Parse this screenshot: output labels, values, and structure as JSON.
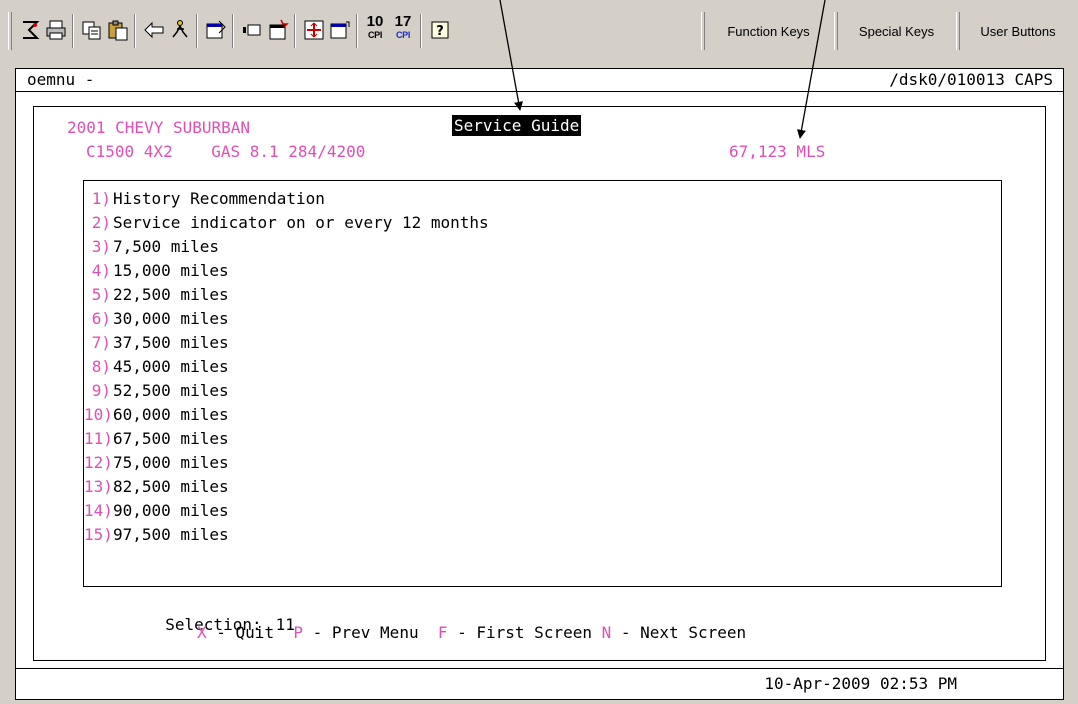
{
  "toolbar": {
    "icons": [
      "printer-setup-icon",
      "print-icon",
      "copy-icon",
      "paste-icon",
      "back-arrow-icon",
      "run-icon",
      "properties-icon",
      "record-icon",
      "new-window-icon",
      "fullscreen-icon",
      "exit-window-icon",
      "help-icon"
    ],
    "cpi_10": {
      "num": "10",
      "lbl": "CPI"
    },
    "cpi_17": {
      "num": "17",
      "lbl": "CPI"
    },
    "function_keys": "Function Keys",
    "special_keys": "Special Keys",
    "user_buttons": "User Buttons"
  },
  "terminal": {
    "header_left": "oemnu -",
    "header_right": "/dsk0/010013 CAPS",
    "vehicle_line1": "2001 CHEVY SUBURBAN",
    "vehicle_line2": "C1500 4X2    GAS 8.1 284/4200",
    "title": "Service Guide",
    "mileage": "67,123 MLS",
    "menu_items": [
      {
        "num": "1)",
        "label": "History Recommendation"
      },
      {
        "num": "2)",
        "label": "Service indicator on or every 12 months"
      },
      {
        "num": "3)",
        "label": "7,500 miles"
      },
      {
        "num": "4)",
        "label": "15,000 miles"
      },
      {
        "num": "5)",
        "label": "22,500 miles"
      },
      {
        "num": "6)",
        "label": "30,000 miles"
      },
      {
        "num": "7)",
        "label": "37,500 miles"
      },
      {
        "num": "8)",
        "label": "45,000 miles"
      },
      {
        "num": "9)",
        "label": "52,500 miles"
      },
      {
        "num": "10)",
        "label": "60,000 miles"
      },
      {
        "num": "11)",
        "label": "67,500 miles"
      },
      {
        "num": "12)",
        "label": "75,000 miles"
      },
      {
        "num": "13)",
        "label": "82,500 miles"
      },
      {
        "num": "14)",
        "label": "90,000 miles"
      },
      {
        "num": "15)",
        "label": "97,500 miles"
      }
    ],
    "selection_label": "Selection:",
    "selection_value": "11",
    "keys": [
      {
        "key": "X",
        "label": " - Quit  "
      },
      {
        "key": "P",
        "label": " - Prev Menu  "
      },
      {
        "key": "F",
        "label": " - First Screen "
      },
      {
        "key": "N",
        "label": " - Next Screen"
      }
    ],
    "timestamp": "10-Apr-2009 02:53 PM"
  },
  "colors": {
    "accent_pink": "#e04fb5",
    "background": "#d4d0c8",
    "terminal_bg": "#ffffff"
  }
}
